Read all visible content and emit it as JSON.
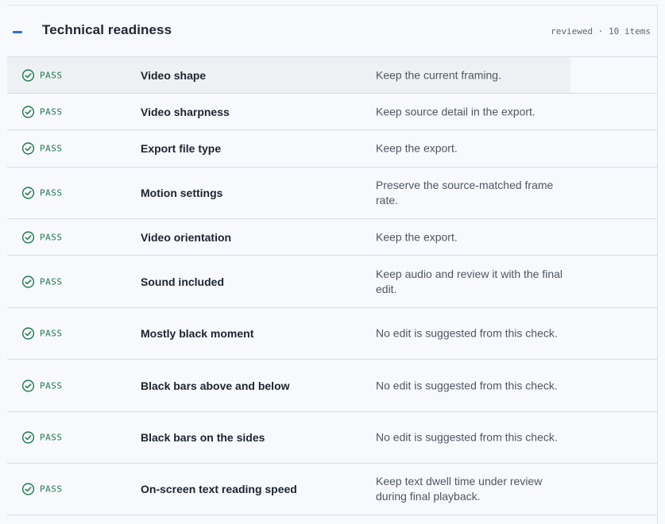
{
  "section": {
    "title": "Technical readiness",
    "meta": "reviewed · 10 items",
    "toggle_icon": "minus-icon"
  },
  "colors": {
    "accent": "#2d6fd6",
    "pass": "#1f7a4c",
    "background": "#f7f9fd",
    "hover_row": "#eef1f4"
  },
  "rows": [
    {
      "status": "PASS",
      "name": "Video shape",
      "recommendation": "Keep the current framing."
    },
    {
      "status": "PASS",
      "name": "Video sharpness",
      "recommendation": "Keep source detail in the export."
    },
    {
      "status": "PASS",
      "name": "Export file type",
      "recommendation": "Keep the export."
    },
    {
      "status": "PASS",
      "name": "Motion settings",
      "recommendation": "Preserve the source-matched frame rate."
    },
    {
      "status": "PASS",
      "name": "Video orientation",
      "recommendation": "Keep the export."
    },
    {
      "status": "PASS",
      "name": "Sound included",
      "recommendation": "Keep audio and review it with the final edit."
    },
    {
      "status": "PASS",
      "name": "Mostly black moment",
      "recommendation": "No edit is suggested from this check."
    },
    {
      "status": "PASS",
      "name": "Black bars above and below",
      "recommendation": "No edit is suggested from this check."
    },
    {
      "status": "PASS",
      "name": "Black bars on the sides",
      "recommendation": "No edit is suggested from this check."
    },
    {
      "status": "PASS",
      "name": "On-screen text reading speed",
      "recommendation": "Keep text dwell time under review during final playback."
    }
  ]
}
